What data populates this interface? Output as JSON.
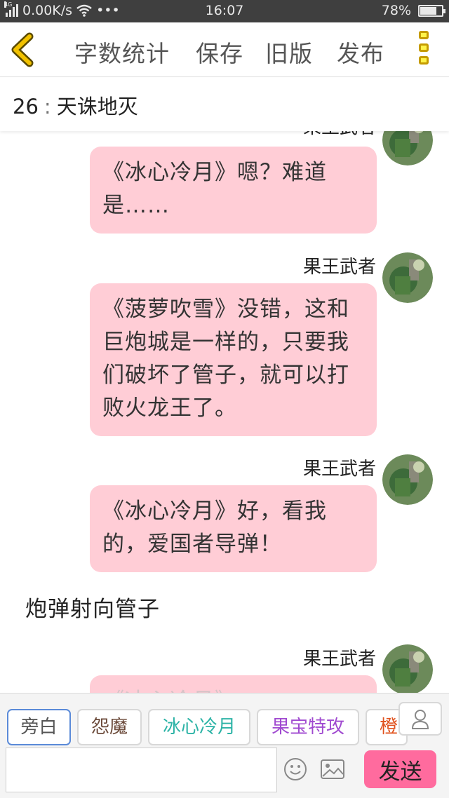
{
  "status_bar": {
    "network_tag": "4G",
    "speed": "0.00K/s",
    "dots": "•••",
    "time": "16:07",
    "battery": "78%",
    "battery_level": 0.78
  },
  "toolbar": {
    "word_count": "字数统计",
    "save": "保存",
    "old_version": "旧版",
    "publish": "发布"
  },
  "chapter": {
    "number": "26",
    "separator": ":",
    "title": "天诛地灭"
  },
  "messages": [
    {
      "sender": "果王武者",
      "text": "《冰心冷月》嗯？难道是……"
    },
    {
      "sender": "果王武者",
      "text": "《菠萝吹雪》没错，这和巨炮城是一样的，只要我们破坏了管子，就可以打败火龙王了。"
    },
    {
      "sender": "果王武者",
      "text": "《冰心冷月》好，看我的，爱国者导弹！"
    },
    {
      "narration": "炮弹射向管子"
    },
    {
      "sender": "果王武者",
      "text": "《冰心冷月》……"
    }
  ],
  "roles": [
    {
      "label": "旁白",
      "color": "#555555"
    },
    {
      "label": "怨魔",
      "color": "#6b4a3a"
    },
    {
      "label": "冰心冷月",
      "color": "#2cb3a6"
    },
    {
      "label": "果宝特攻",
      "color": "#a04ad0"
    },
    {
      "label": "橙",
      "color": "#e0521e"
    }
  ],
  "input": {
    "value": "",
    "placeholder": "",
    "send_label": "发送"
  },
  "colors": {
    "bubble": "#ffcdd6",
    "send_button": "#ff6b9e",
    "toolbar_back": "#f2c200"
  }
}
